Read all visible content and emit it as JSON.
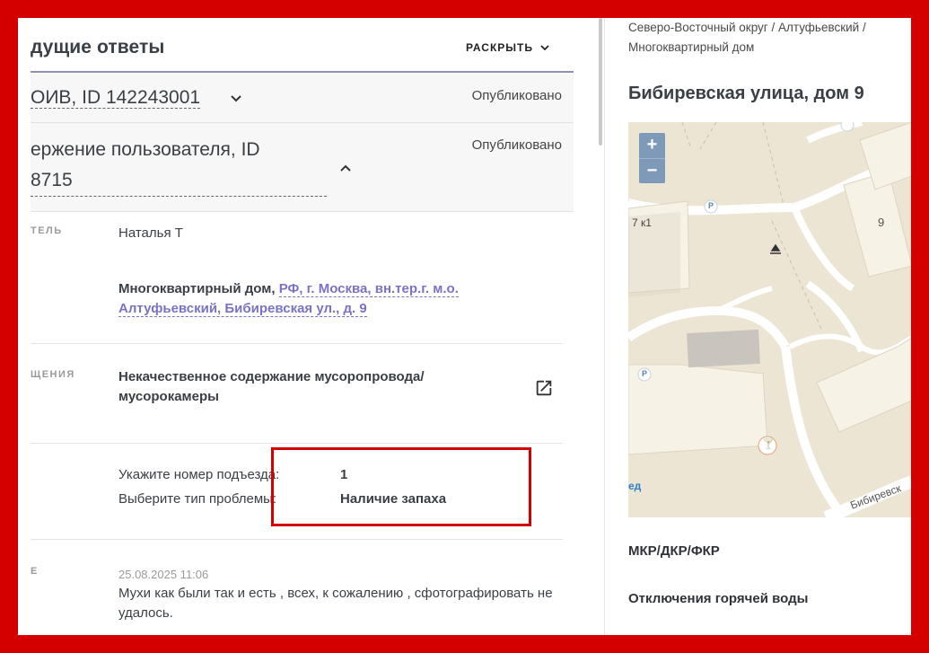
{
  "left": {
    "section_title": "дущие ответы",
    "expand_label": "РАСКРЫТЬ",
    "rows": [
      {
        "title": "ОИВ, ID 142243001",
        "status": "Опубликовано"
      },
      {
        "title_line1": "ержение пользователя, ID",
        "title_line2": "8715",
        "status": "Опубликовано"
      }
    ],
    "author": {
      "label": "ТЕЛЬ",
      "value": "Наталья Т"
    },
    "object": {
      "type": "Многоквартирный дом,",
      "address_line1": "РФ, г. Москва, вн.тер.г. м.о.",
      "address_line2": "Алтуфьевский, Бибиревская ул., д. 9"
    },
    "theme": {
      "label": "ЩЕНИЯ",
      "line1": "Некачественное содержание мусоропровода/",
      "line2": "мусорокамеры"
    },
    "details": [
      {
        "key": "Укажите номер подъезда:",
        "val": "1"
      },
      {
        "key": "Выберите тип проблемы:",
        "val": "Наличие запаха"
      }
    ],
    "message": {
      "label": "Е",
      "date": "25.08.2025 11:06",
      "line1": "Мухи как были так и есть , всех, к сожалению , сфотографировать не",
      "line2": "удалось."
    }
  },
  "right": {
    "breadcrumb_line1": "Северо-Восточный округ / Алтуфьевский /",
    "breadcrumb_line2": "Многоквартирный дом",
    "address_title": "Бибиревская улица, дом 9",
    "map": {
      "zoom_in": "+",
      "zoom_out": "−",
      "labels": {
        "bldg_left": "7 к1",
        "bldg_right": "9",
        "street": "Бибиревск",
        "edge": "ед"
      },
      "parking": "P",
      "colors": {
        "bg": "#ece5d3",
        "road": "#ffffff",
        "bldg": "#f6f2e6",
        "zoom": "#7f99b8"
      }
    },
    "items": [
      "МКР/ДКР/ФКР",
      "Отключения горячей воды"
    ]
  }
}
